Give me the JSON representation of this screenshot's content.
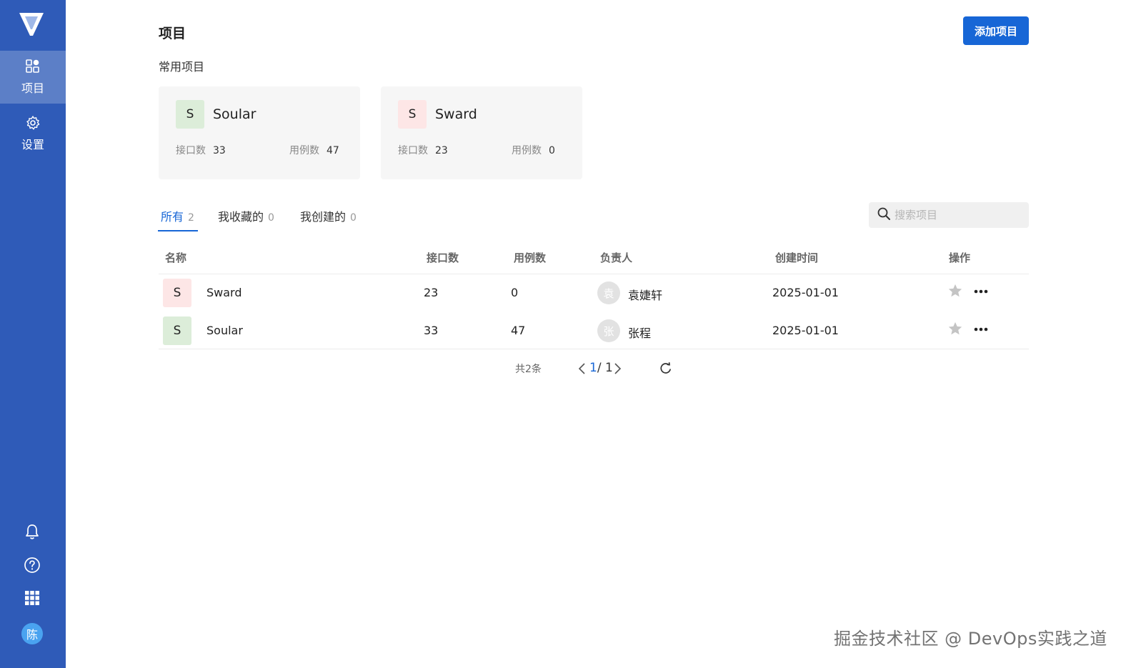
{
  "sidebar": {
    "logo_icon": "app-logo",
    "items": [
      {
        "label": "项目",
        "icon": "grid-apps-icon",
        "active": true
      },
      {
        "label": "设置",
        "icon": "gear-icon",
        "active": false
      }
    ],
    "bottom_icons": [
      "bell-icon",
      "help-icon",
      "app-launcher-icon"
    ],
    "user_avatar": "陈"
  },
  "header": {
    "title": "项目",
    "add_button": "添加项目"
  },
  "recent": {
    "title": "常用项目",
    "cards": [
      {
        "initial": "S",
        "name": "Soular",
        "api_label": "接口数",
        "api_count": "33",
        "case_label": "用例数",
        "case_count": "47",
        "color": "#dcedd9"
      },
      {
        "initial": "S",
        "name": "Sward",
        "api_label": "接口数",
        "api_count": "23",
        "case_label": "用例数",
        "case_count": "0",
        "color": "#fde6e6"
      }
    ]
  },
  "tabs": [
    {
      "label": "所有",
      "count": "2",
      "active": true
    },
    {
      "label": "我收藏的",
      "count": "0",
      "active": false
    },
    {
      "label": "我创建的",
      "count": "0",
      "active": false
    }
  ],
  "search": {
    "placeholder": "搜索项目"
  },
  "table": {
    "headers": [
      "名称",
      "接口数",
      "用例数",
      "负责人",
      "创建时间",
      "操作"
    ],
    "rows": [
      {
        "initial": "S",
        "name": "Sward",
        "api": "23",
        "cases": "0",
        "owner_initial": "袁",
        "owner": "袁婕轩",
        "created": "2025-01-01",
        "color": "#fde6e6"
      },
      {
        "initial": "S",
        "name": "Soular",
        "api": "33",
        "cases": "47",
        "owner_initial": "张",
        "owner": "张程",
        "created": "2025-01-01",
        "color": "#dcedd9"
      }
    ]
  },
  "pagination": {
    "total": "共2条",
    "current": "1",
    "sep_total": "/ 1"
  },
  "watermark": "掘金技术社区 @ DevOps实践之道",
  "colors": {
    "sidebar": "#2f5bb8",
    "accent": "#1766d6"
  }
}
